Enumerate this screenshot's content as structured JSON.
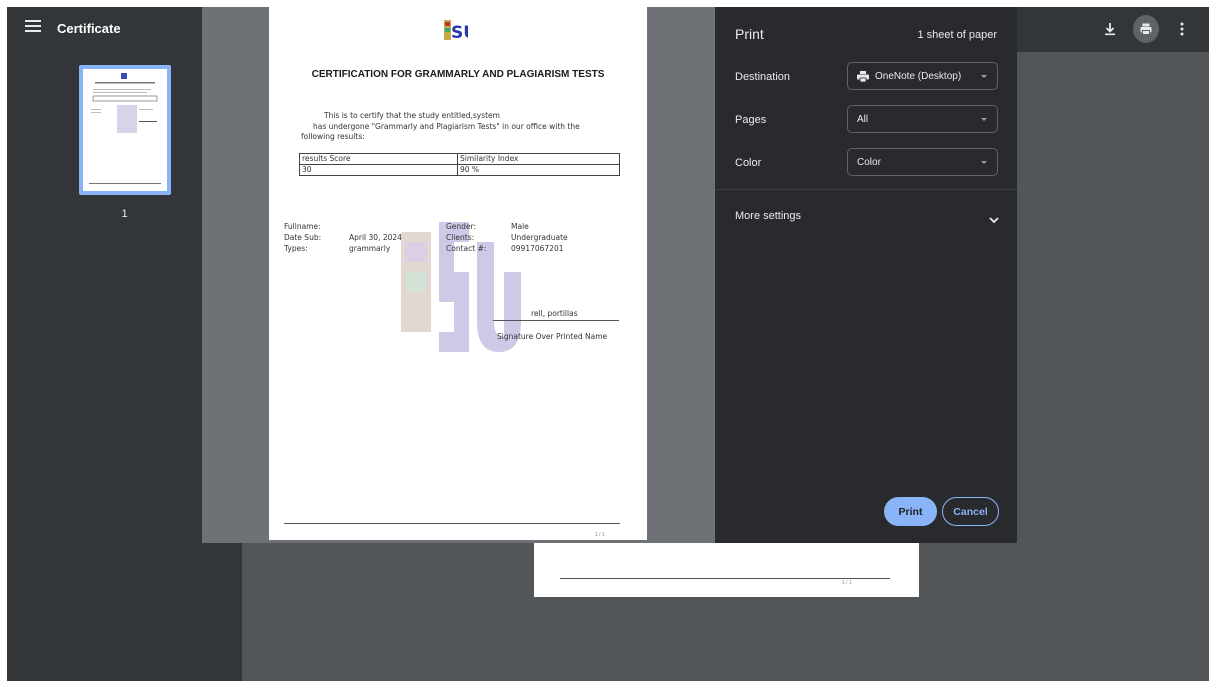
{
  "toolbar": {
    "title": "Certificate",
    "icons": [
      "menu-icon",
      "download-icon",
      "print-icon",
      "more-vert-icon"
    ]
  },
  "sidebar": {
    "page_number": "1"
  },
  "document": {
    "heading": "CERTIFICATION FOR GRAMMARLY AND PLAGIARISM TESTS",
    "intro_line1": "This is to certify that the study entitled,system",
    "intro_line2": "has undergone \"Grammarly and Plagiarism Tests\" in our office with the",
    "intro_line3": "following results:",
    "table": {
      "headers": [
        "results Score",
        "Similarity Index"
      ],
      "rows": [
        [
          "30",
          "90 %"
        ]
      ]
    },
    "fields": {
      "fullname_label": "Fullname:",
      "fullname_value": "",
      "date_label": "Date Sub:",
      "date_value": "April 30, 2024",
      "types_label": "Types:",
      "types_value": "grammarly",
      "gender_label": "Gender:",
      "gender_value": "Male",
      "clients_label": "Clients:",
      "clients_value": "Undergraduate",
      "contact_label": "Contact #:",
      "contact_value": "09917067201"
    },
    "signature_name": "rell, portillas",
    "signature_caption": "Signature Over Printed Name",
    "footer_page": "1 / 1",
    "logo_text": "SU"
  },
  "print_panel": {
    "title": "Print",
    "sheets": "1 sheet of paper",
    "destination_label": "Destination",
    "destination_value": "OneNote (Desktop)",
    "pages_label": "Pages",
    "pages_value": "All",
    "color_label": "Color",
    "color_value": "Color",
    "more_settings_label": "More settings",
    "print_button": "Print",
    "cancel_button": "Cancel"
  },
  "colors": {
    "accent": "#8ab4f8",
    "panel_bg": "#292a2d",
    "toolbar_bg": "#323639",
    "viewer_bg": "#525659"
  }
}
